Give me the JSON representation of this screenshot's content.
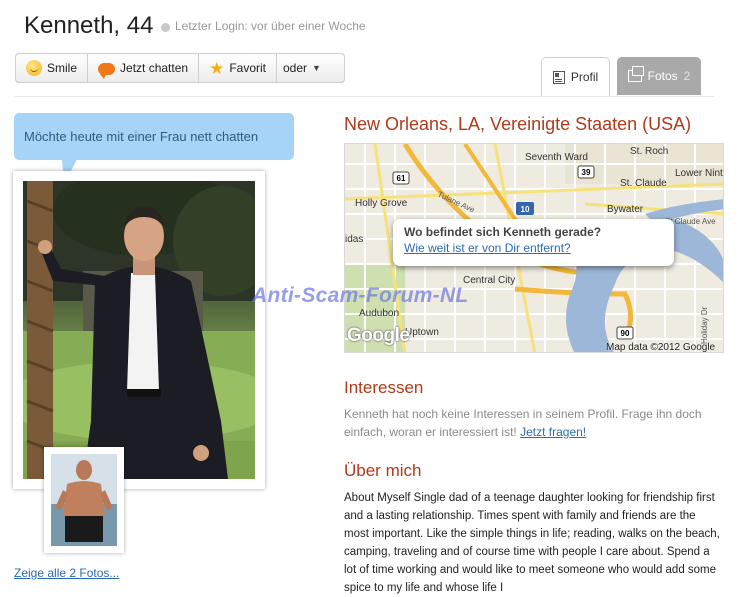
{
  "header": {
    "name": "Kenneth, 44",
    "last_login": "Letzter Login: vor über einer Woche"
  },
  "actions": {
    "smile": "Smile",
    "chat": "Jetzt chatten",
    "favorite": "Favorit",
    "more": "oder"
  },
  "tabs": [
    {
      "label": "Profil"
    },
    {
      "label": "Fotos",
      "count": "2"
    }
  ],
  "status": {
    "text": "Möchte heute mit einer Frau nett chatten"
  },
  "photos": {
    "show_all": "Zeige alle 2 Fotos..."
  },
  "location": {
    "title": "New Orleans, LA, Vereinigte Staaten (USA)",
    "popup_title": "Wo befindet sich Kenneth gerade?",
    "popup_link": "Wie weit ist er von Dir entfernt?",
    "map_attribution": "Map data ©2012 Google",
    "map_logo": "Google",
    "map_labels": {
      "seventh_ward": "Seventh Ward",
      "st_claude": "St. Claude",
      "bywater": "Bywater",
      "lower_ninth": "Lower Ninth Ward",
      "holly_grove": "Holly Grove",
      "central_city": "Central City",
      "audubon": "Audubon",
      "uptown": "Uptown",
      "tulane_ave": "Tulane Ave",
      "st_claude_ave": "St Claude Ave",
      "holiday_dr": "Holiday Dr",
      "st_roch": "St. Roch",
      "midas": "idas",
      "hwy_61": "61",
      "hwy_10": "10",
      "hwy_39": "39",
      "hwy_90": "90"
    }
  },
  "interests": {
    "title": "Interessen",
    "text": "Kenneth hat noch keine Interessen in seinem Profil. Frage ihn doch einfach, woran er interessiert ist!",
    "link": "Jetzt fragen!"
  },
  "about": {
    "title": "Über mich",
    "text": "About Myself Single dad of a teenage daughter looking for friendship first and a lasting relationship. Times spent with family and friends are the most important. Like the simple things in life; reading, walks on the beach, camping, traveling and of course time with people I care about. Spend a lot of time working and would like to meet someone who would add some spice to my life and whose life I"
  },
  "watermark": "Anti-Scam-Forum-NL",
  "colors": {
    "accent_red": "#b03a1a",
    "link_blue": "#2a6cb0",
    "bubble_blue": "#a6d4f8",
    "tab_gray": "#a9a9a9"
  }
}
